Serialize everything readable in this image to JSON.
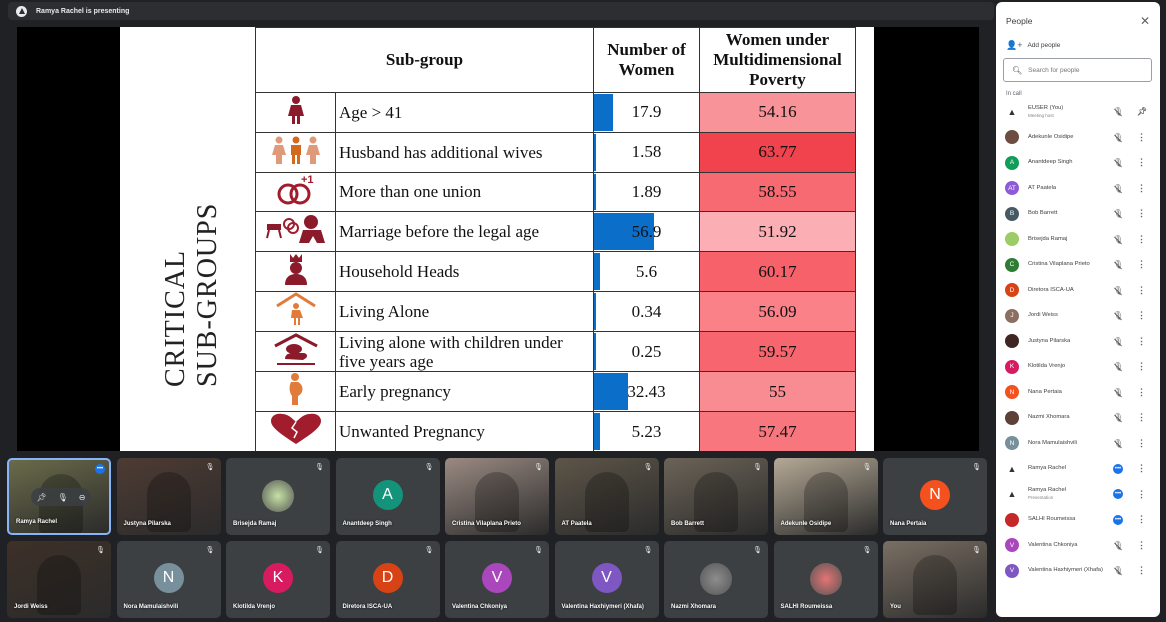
{
  "presenting_bar": {
    "text": "Ramya Rachel is presenting"
  },
  "slide": {
    "vertical_title_line1": "CRITICAL",
    "vertical_title_line2": "SUB-GROUPS",
    "headers": {
      "subgroup": "Sub-group",
      "number": "Number of Women",
      "poverty": "Women under Multidimensional Poverty"
    },
    "rows": [
      {
        "icon": "woman-icon",
        "label": "Age > 41",
        "number": "17.9",
        "number_pct": 17.9,
        "poverty": "54.16",
        "poverty_color": "#f8939a"
      },
      {
        "icon": "polygamy-family-icon",
        "label": "Husband has additional wives",
        "number": "1.58",
        "number_pct": 1.58,
        "poverty": "63.77",
        "poverty_color": "#f1434e"
      },
      {
        "icon": "rings-plus-one-icon",
        "label": "More than one union",
        "number": "1.89",
        "number_pct": 1.89,
        "poverty": "58.55",
        "poverty_color": "#f86a72"
      },
      {
        "icon": "child-marriage-icon",
        "label": "Marriage before the legal age",
        "number": "56.9",
        "number_pct": 56.9,
        "poverty": "51.92",
        "poverty_color": "#fbaeb4"
      },
      {
        "icon": "crowned-head-icon",
        "label": "Household Heads",
        "number": "5.6",
        "number_pct": 5.6,
        "poverty": "60.17",
        "poverty_color": "#f6616a"
      },
      {
        "icon": "woman-in-house-icon",
        "label": "Living Alone",
        "number": "0.34",
        "number_pct": 0.34,
        "poverty": "56.09",
        "poverty_color": "#f98187"
      },
      {
        "icon": "mother-child-house-icon",
        "label": "Living alone with children under five years age",
        "number": "0.25",
        "number_pct": 0.25,
        "poverty": "59.57",
        "poverty_color": "#f7666e"
      },
      {
        "icon": "pregnant-woman-icon",
        "label": "Early pregnancy",
        "number": "32.43",
        "number_pct": 32.43,
        "poverty": "55",
        "poverty_color": "#f98c92"
      },
      {
        "icon": "broken-heart-baby-icon",
        "label": "Unwanted Pregnancy",
        "number": "5.23",
        "number_pct": 5.23,
        "poverty": "57.47",
        "poverty_color": "#f8767d"
      }
    ]
  },
  "people_panel": {
    "title": "People",
    "add_people": "Add people",
    "search_placeholder": "Search for people",
    "in_call_label": "In call",
    "participants": [
      {
        "name": "EUSER (You)",
        "sub": "Meeting host",
        "avatar": "logo",
        "color": "#ffffff",
        "status": "muted",
        "action": "pin"
      },
      {
        "name": "Adekunle Osidipe",
        "avatar": "photo",
        "color": "#6d4c41",
        "status": "muted"
      },
      {
        "name": "Anantdeep Singh",
        "avatar": "A",
        "color": "#0f9d58",
        "status": "muted"
      },
      {
        "name": "AT Paatela",
        "avatar": "AT",
        "color": "#8e5ad8",
        "status": "muted"
      },
      {
        "name": "Bob Barrett",
        "avatar": "B",
        "color": "#455a64",
        "status": "muted"
      },
      {
        "name": "Brisejda Ramaj",
        "avatar": "photo",
        "color": "#9ccc65",
        "status": "muted"
      },
      {
        "name": "Cristina Vilaplana Prieto",
        "avatar": "C",
        "color": "#2e7d32",
        "status": "muted"
      },
      {
        "name": "Diretora ISCA-UA",
        "avatar": "D",
        "color": "#d84315",
        "status": "muted"
      },
      {
        "name": "Jordi Weiss",
        "avatar": "J",
        "color": "#8d6e63",
        "status": "muted"
      },
      {
        "name": "Justyna Pilarska",
        "avatar": "photo",
        "color": "#3e2723",
        "status": "muted"
      },
      {
        "name": "Klotilda Vrenjo",
        "avatar": "K",
        "color": "#d81b60",
        "status": "muted"
      },
      {
        "name": "Nana Pertaia",
        "avatar": "N",
        "color": "#f4511e",
        "status": "muted"
      },
      {
        "name": "Nazmi Xhomara",
        "avatar": "photo",
        "color": "#5d4037",
        "status": "muted"
      },
      {
        "name": "Nora Mamulaishvili",
        "avatar": "N",
        "color": "#78909c",
        "status": "muted"
      },
      {
        "name": "Ramya Rachel",
        "avatar": "logo",
        "color": "#ffffff",
        "status": "speaking"
      },
      {
        "name": "Ramya Rachel",
        "sub": "Presentation",
        "avatar": "logo",
        "color": "#ffffff",
        "status": "speaking"
      },
      {
        "name": "SALHI Roumeissa",
        "avatar": "photo",
        "color": "#c62828",
        "status": "speaking"
      },
      {
        "name": "Valentina Chkoniya",
        "avatar": "V",
        "color": "#ab47bc",
        "status": "muted"
      },
      {
        "name": "Valentina Haxhiymeri (Xhafa)",
        "avatar": "V",
        "color": "#7e57c2",
        "status": "muted"
      }
    ]
  },
  "tiles": [
    {
      "name": "Ramya Rachel",
      "type": "video",
      "bg": "#6a6b4a",
      "active": true
    },
    {
      "name": "Justyna Pilarska",
      "type": "video",
      "bg": "#4e3b33"
    },
    {
      "name": "Brisejda Ramaj",
      "type": "photo",
      "photo_color": "#c5e1a5"
    },
    {
      "name": "Anantdeep Singh",
      "type": "letter",
      "letter": "A",
      "color": "#12937a"
    },
    {
      "name": "Cristina Vilaplana Prieto",
      "type": "video",
      "bg": "#9a8a82"
    },
    {
      "name": "AT Paatela",
      "type": "video",
      "bg": "#5d5548"
    },
    {
      "name": "Bob Barrett",
      "type": "video",
      "bg": "#6b6357"
    },
    {
      "name": "Adekunle Osidipe",
      "type": "video",
      "bg": "#b5a996"
    },
    {
      "name": "Nana Pertaia",
      "type": "letter",
      "letter": "N",
      "color": "#f4511e"
    },
    {
      "name": "Jordi Weiss",
      "type": "video",
      "bg": "#3d3028"
    },
    {
      "name": "Nora Mamulaishvili",
      "type": "letter",
      "letter": "N",
      "color": "#78909c"
    },
    {
      "name": "Klotilda Vrenjo",
      "type": "letter",
      "letter": "K",
      "color": "#d81b60"
    },
    {
      "name": "Diretora ISCA-UA",
      "type": "letter",
      "letter": "D",
      "color": "#d84315"
    },
    {
      "name": "Valentina Chkoniya",
      "type": "letter",
      "letter": "V",
      "color": "#ab47bc"
    },
    {
      "name": "Valentina Haxhiymeri (Xhafa)",
      "type": "letter",
      "letter": "V",
      "color": "#7e57c2"
    },
    {
      "name": "Nazmi Xhomara",
      "type": "photo",
      "photo_color": "#8d8d8d"
    },
    {
      "name": "SALHI Roumeissa",
      "type": "photo",
      "photo_color": "#e57373"
    },
    {
      "name": "You",
      "type": "video",
      "bg": "#7a6f63"
    }
  ],
  "tile_controls": {
    "pin": "pin-icon",
    "mic": "mic-icon",
    "remove": "remove-icon"
  }
}
